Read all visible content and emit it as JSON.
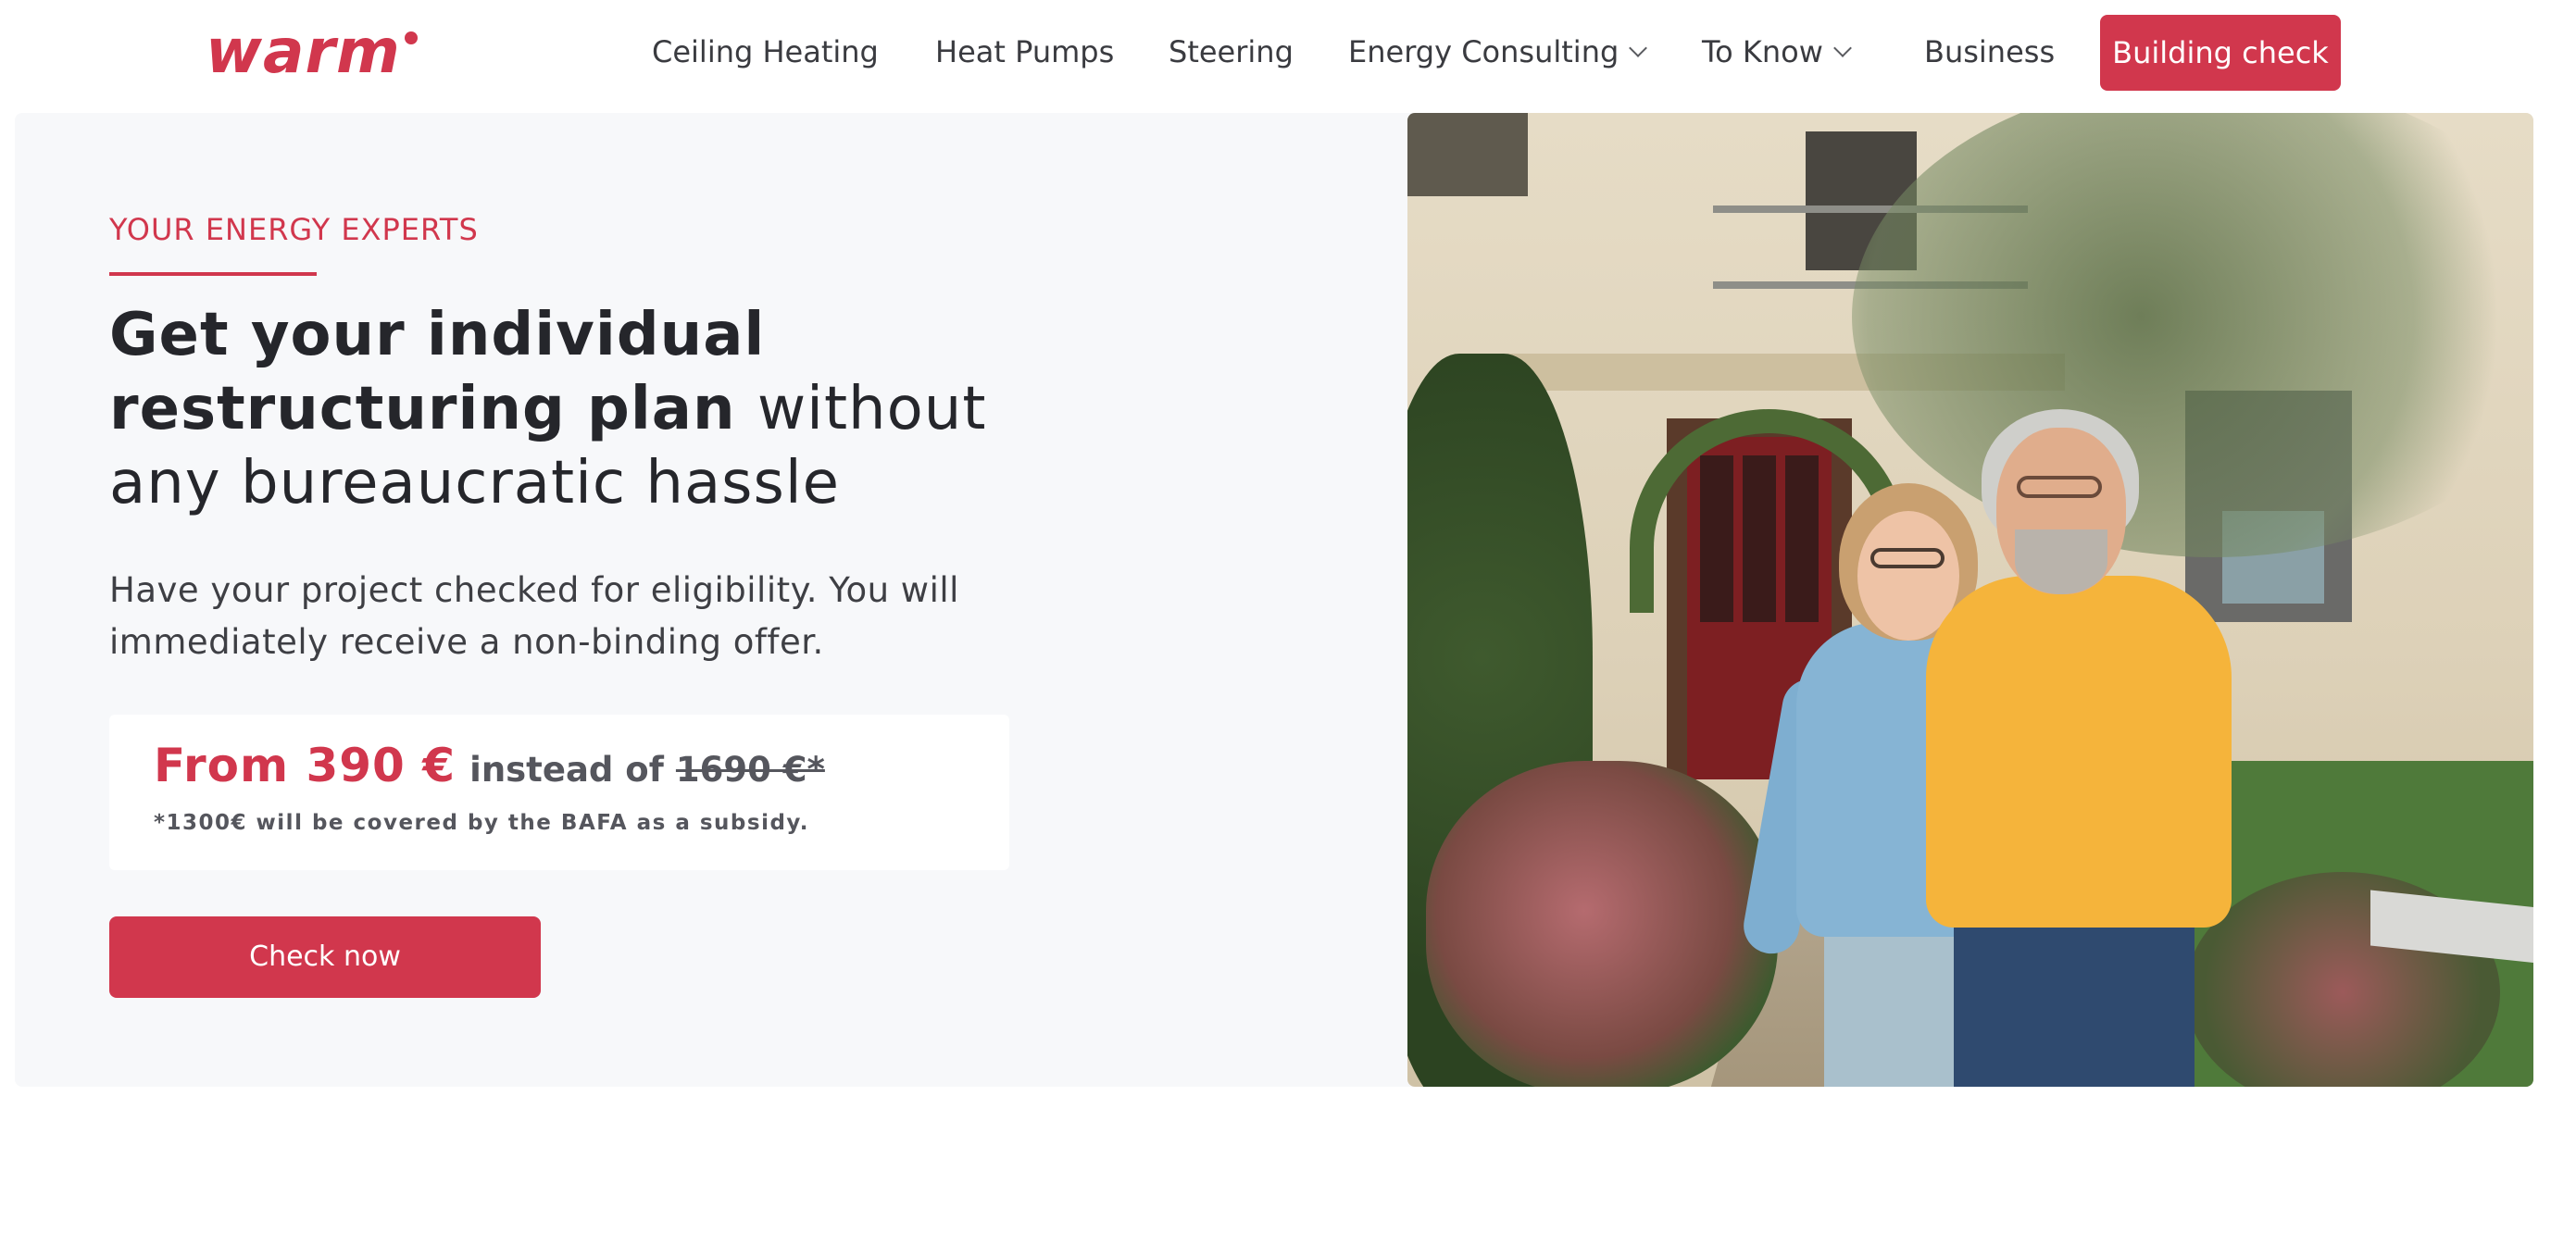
{
  "brand": {
    "logo_text": "warm",
    "accent_color": "#d1374d"
  },
  "nav": {
    "items": [
      {
        "label": "Ceiling Heating",
        "has_dropdown": false
      },
      {
        "label": "Heat Pumps",
        "has_dropdown": false
      },
      {
        "label": "Steering",
        "has_dropdown": false
      },
      {
        "label": "Energy Consulting",
        "has_dropdown": true,
        "icon": "chevron-down-icon"
      },
      {
        "label": "To Know",
        "has_dropdown": true,
        "icon": "chevron-down-icon"
      },
      {
        "label": "Business",
        "has_dropdown": false
      }
    ],
    "cta_label": "Building check"
  },
  "hero": {
    "eyebrow": "YOUR ENERGY EXPERTS",
    "headline_bold": "Get your individual restructuring plan",
    "headline_regular": "without any bureaucratic hassle",
    "lead": "Have your project checked for eligibility. You will immediately receive a non-binding offer.",
    "price": {
      "main": "From 390 €",
      "instead_label": "instead of",
      "old_price": "1690 €*",
      "note": "*1300€ will be covered by the BAFA as a subsidy."
    },
    "cta_label": "Check now"
  },
  "image": {
    "subject": "couple-in-front-of-house-photo"
  }
}
